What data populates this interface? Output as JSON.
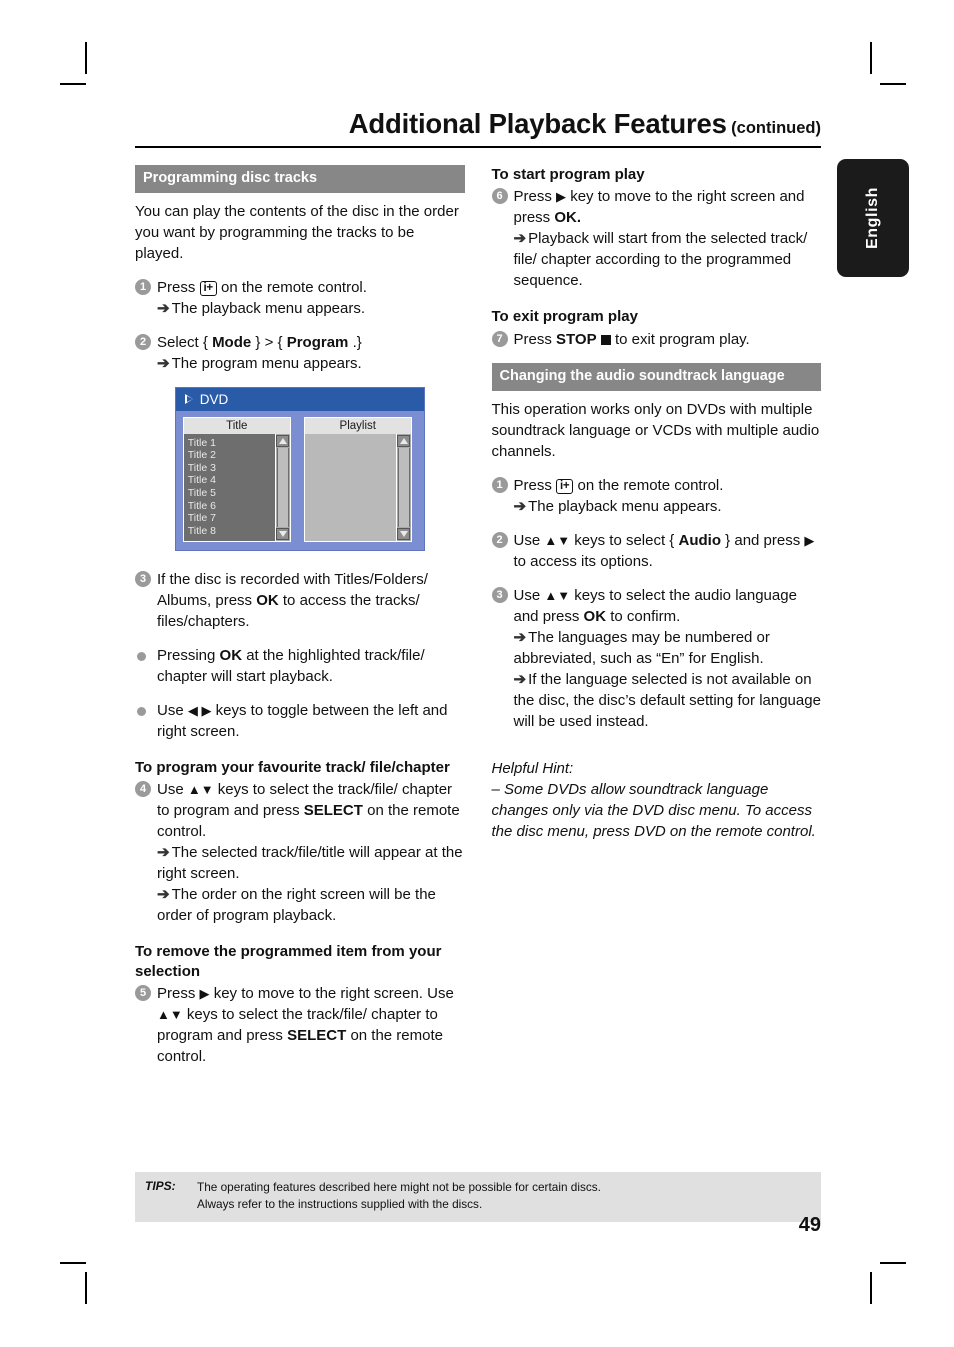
{
  "header": {
    "title": "Additional Playback Features",
    "continued": "(continued)"
  },
  "side_tab": {
    "label": "English"
  },
  "left_column": {
    "section_title": "Programming disc tracks",
    "intro": "You can play the contents of the disc in the order you want by programming the tracks to be played.",
    "step1": {
      "num": "1",
      "text_before": "Press",
      "key": "i+",
      "text_after": "on the remote control.",
      "result": "The playback menu appears."
    },
    "step2": {
      "num": "2",
      "text": "Select { Mode } > { Program .}",
      "label_select": "Select",
      "brace_open": "{",
      "mode": "Mode",
      "brace_close_gt": "} > {",
      "program": "Program",
      "brace_end": ".}",
      "result": "The program menu appears."
    },
    "dvd_screen": {
      "title": "DVD",
      "left_pane_header": "Title",
      "right_pane_header": "Playlist",
      "titles": [
        "Title 1",
        "Title 2",
        "Title 3",
        "Title 4",
        "Title 5",
        "Title 6",
        "Title 7",
        "Title 8"
      ],
      "playlist_items": [],
      "colors": {
        "titlebar": "#2a5ba8",
        "background": "#7b8ed1",
        "list_body": "#6e6e6e",
        "playlist_body": "#b9b9b9"
      }
    },
    "step3": {
      "num": "3",
      "part1": "If the disc is recorded with Titles/Folders/ Albums, press",
      "bold": "OK",
      "part2": "to access the tracks/ files/chapters."
    },
    "bullet1": {
      "part1": "Pressing",
      "bold": "OK",
      "part2": "at the highlighted track/file/ chapter will start playback."
    },
    "bullet2": {
      "part1": "Use",
      "keys": "◀ ▶",
      "part2": "keys to toggle between the left and right screen."
    },
    "subhead_program": "To program your favourite track/ file/chapter",
    "step4": {
      "num": "4",
      "part1": "Use",
      "keys": "▲▼",
      "part2": "keys to select the track/file/ chapter to program and press",
      "bold": "SELECT",
      "part3": "on the remote control.",
      "result1": "The selected track/file/title will appear at the right screen.",
      "result2": "The order on the right screen will be the order of program playback."
    },
    "subhead_remove": "To remove the programmed item from your selection",
    "step5": {
      "num": "5",
      "part1": "Press",
      "key_right": "▶",
      "part2": "key to move to the right screen. Use",
      "keys": "▲▼",
      "part3": "keys to select the track/file/ chapter to program and press",
      "bold": "SELECT",
      "part4": "on the remote control."
    }
  },
  "right_column": {
    "subhead_start": "To start program play",
    "step6": {
      "num": "6",
      "part1": "Press",
      "key_right": "▶",
      "part2": "key to move to the right screen and press",
      "bold": "OK.",
      "result": "Playback will start from the selected track/ file/ chapter according to the programmed sequence."
    },
    "subhead_exit": "To exit program play",
    "step7": {
      "num": "7",
      "part1": "Press",
      "bold": "STOP",
      "part2": "to exit program play."
    },
    "section_title": "Changing the audio soundtrack language",
    "intro": "This operation works only on DVDs with multiple soundtrack language or VCDs with multiple audio channels.",
    "step1": {
      "num": "1",
      "text_before": "Press",
      "key": "i+",
      "text_after": "on the remote control.",
      "result": "The playback menu appears."
    },
    "step2": {
      "num": "2",
      "part1": "Use",
      "keys": "▲▼",
      "part2": "keys to select {",
      "bold": "Audio",
      "part3": "} and press",
      "key_right": "▶",
      "part4": "to access its options."
    },
    "step3": {
      "num": "3",
      "part1": "Use",
      "keys": "▲▼",
      "part2": "keys to select the audio language and press",
      "bold": "OK",
      "part3": "to confirm.",
      "result1": "The languages may be numbered or abbreviated, such as “En” for English.",
      "result2": "If the language selected is not available on the disc, the disc’s default setting for language will be used instead."
    },
    "hint_title": "Helpful Hint:",
    "hint_body": "– Some DVDs allow soundtrack language changes only via the DVD disc menu. To access the disc menu, press DVD on the remote control."
  },
  "footer": {
    "tips_label": "TIPS:",
    "tips_line1": "The operating features described here might not be possible for certain discs.",
    "tips_line2": "Always refer to the instructions supplied with the discs.",
    "page_number": "49"
  }
}
